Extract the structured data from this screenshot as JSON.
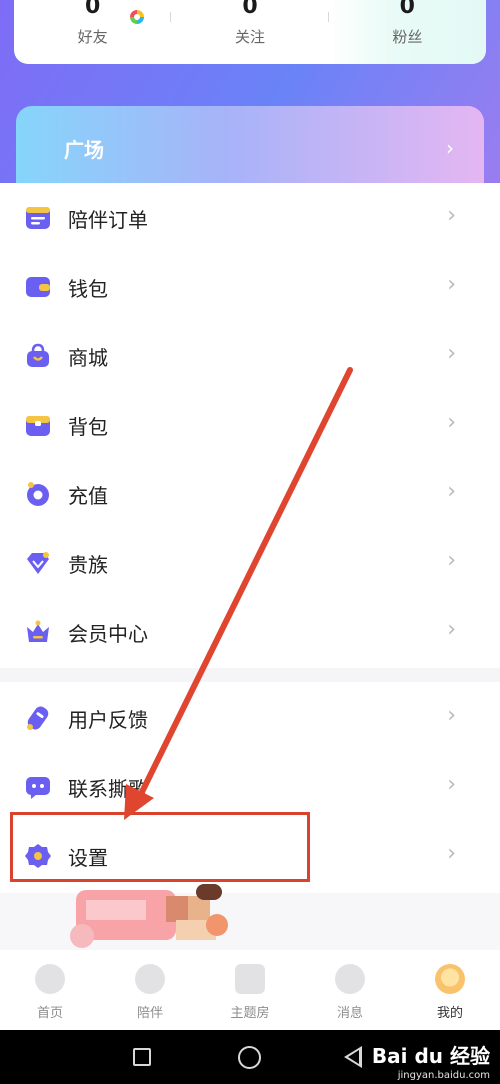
{
  "stats": {
    "friends": {
      "value": "0",
      "label": "好友"
    },
    "following": {
      "value": "0",
      "label": "关注"
    },
    "fans": {
      "value": "0",
      "label": "粉丝"
    }
  },
  "plaza": {
    "title": "广场",
    "chevron": "›"
  },
  "menu": {
    "group1": [
      {
        "label": "陪伴订单",
        "icon": "order-icon"
      },
      {
        "label": "钱包",
        "icon": "wallet-icon"
      },
      {
        "label": "商城",
        "icon": "shop-bag-icon"
      },
      {
        "label": "背包",
        "icon": "backpack-icon"
      },
      {
        "label": "充值",
        "icon": "recharge-coin-icon"
      },
      {
        "label": "贵族",
        "icon": "noble-gem-icon"
      },
      {
        "label": "会员中心",
        "icon": "crown-icon"
      }
    ],
    "group2": [
      {
        "label": "用户反馈",
        "icon": "feedback-pen-icon"
      },
      {
        "label": "联系撕歌",
        "icon": "chat-bubble-icon"
      },
      {
        "label": "设置",
        "icon": "settings-gear-icon"
      }
    ],
    "arrow": "›"
  },
  "navbar": {
    "items": [
      {
        "label": "首页",
        "icon": "home-icon"
      },
      {
        "label": "陪伴",
        "icon": "heart-icon"
      },
      {
        "label": "主题房",
        "icon": "house-icon"
      },
      {
        "label": "消息",
        "icon": "message-icon"
      },
      {
        "label": "我的",
        "icon": "profile-avatar-icon"
      }
    ]
  },
  "watermark": {
    "main": "Bai du 经验",
    "sub": "jingyan.baidu.com"
  },
  "colors": {
    "accent": "#6b5cf0",
    "highlight": "#d9432d",
    "icon": "#6a5ff0"
  }
}
